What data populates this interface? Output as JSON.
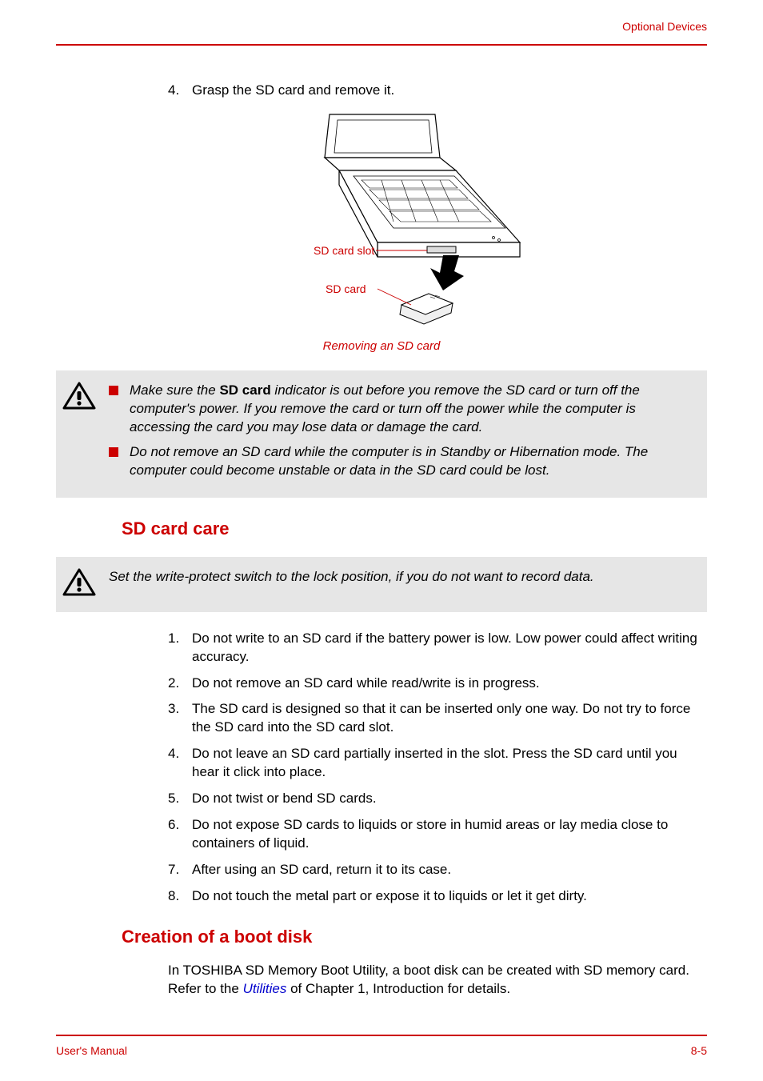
{
  "header": {
    "section_title": "Optional Devices"
  },
  "step4": {
    "num": "4.",
    "text": "Grasp the SD card and remove it."
  },
  "figure": {
    "callout_slot": "SD card slot",
    "callout_card": "SD card",
    "caption": "Removing an SD card"
  },
  "warning1": {
    "bullet1_pre": "Make sure the ",
    "bullet1_bold": "SD card",
    "bullet1_post": " indicator is out before you remove the SD card or turn off the computer's power. If you remove the card or turn off the power while the computer is accessing the card you may lose data or damage the card.",
    "bullet2": "Do not remove an SD card while the computer is in Standby or Hibernation mode. The computer could become unstable or data in the SD card could be lost."
  },
  "heading_card_care": "SD card care",
  "warning2": {
    "text": "Set the write-protect switch to the lock position, if you do not want to record data."
  },
  "care_list": {
    "items": [
      {
        "n": "1.",
        "t": "Do not write to an SD card if the battery power is low. Low power could affect writing accuracy."
      },
      {
        "n": "2.",
        "t": "Do not remove an SD card while read/write is in progress."
      },
      {
        "n": "3.",
        "t": "The SD card is designed so that it can be inserted only one way. Do not try to force the SD card into the SD card slot."
      },
      {
        "n": "4.",
        "t": "Do not leave an SD card partially inserted in the slot. Press the SD card until you hear it click into place."
      },
      {
        "n": "5.",
        "t": "Do not twist or bend SD cards."
      },
      {
        "n": "6.",
        "t": "Do not expose SD cards to liquids or store in humid areas or lay media close to containers of liquid."
      },
      {
        "n": "7.",
        "t": "After using an SD card, return it to its case."
      },
      {
        "n": "8.",
        "t": "Do not touch the metal part or expose it to liquids or let it get dirty."
      }
    ]
  },
  "heading_boot_disk": "Creation of a boot disk",
  "boot_para": {
    "pre": "In TOSHIBA SD Memory Boot Utility, a boot disk can be created with SD memory card. Refer to the ",
    "link": "Utilities",
    "post": " of Chapter 1, Introduction for details."
  },
  "footer": {
    "left": "User's Manual",
    "right": "8-5"
  }
}
